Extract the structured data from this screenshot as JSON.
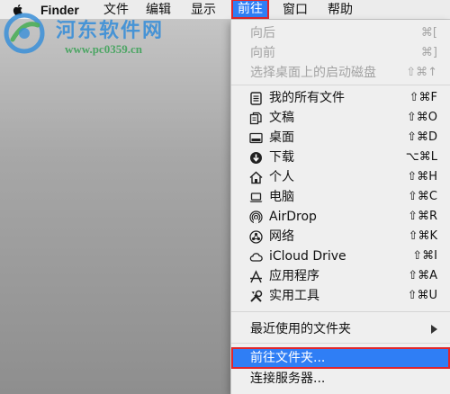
{
  "menubar": {
    "finder": "Finder",
    "file": "文件",
    "edit": "编辑",
    "view": "显示",
    "go": "前往",
    "window": "窗口",
    "help": "帮助"
  },
  "watermark": {
    "title": "河东软件网",
    "url": "www.pc0359.cn"
  },
  "menu": {
    "nav": [
      {
        "label": "向后",
        "shortcut": "⌘[",
        "enabled": false
      },
      {
        "label": "向前",
        "shortcut": "⌘]",
        "enabled": false
      },
      {
        "label": "选择桌面上的启动磁盘",
        "shortcut": "⇧⌘↑",
        "enabled": false
      }
    ],
    "places": [
      {
        "label": "我的所有文件",
        "shortcut": "⇧⌘F",
        "icon": "all-files-icon"
      },
      {
        "label": "文稿",
        "shortcut": "⇧⌘O",
        "icon": "documents-icon"
      },
      {
        "label": "桌面",
        "shortcut": "⇧⌘D",
        "icon": "desktop-icon"
      },
      {
        "label": "下载",
        "shortcut": "⌥⌘L",
        "icon": "downloads-icon"
      },
      {
        "label": "个人",
        "shortcut": "⇧⌘H",
        "icon": "home-icon"
      },
      {
        "label": "电脑",
        "shortcut": "⇧⌘C",
        "icon": "computer-icon"
      },
      {
        "label": "AirDrop",
        "shortcut": "⇧⌘R",
        "icon": "airdrop-icon"
      },
      {
        "label": "网络",
        "shortcut": "⇧⌘K",
        "icon": "network-icon"
      },
      {
        "label": "iCloud Drive",
        "shortcut": "⇧⌘I",
        "icon": "icloud-icon"
      },
      {
        "label": "应用程序",
        "shortcut": "⇧⌘A",
        "icon": "applications-icon"
      },
      {
        "label": "实用工具",
        "shortcut": "⇧⌘U",
        "icon": "utilities-icon"
      }
    ],
    "recent": "最近使用的文件夹",
    "goto_folder": "前往文件夹...",
    "connect_server": "连接服务器..."
  },
  "colors": {
    "highlight": "#2f7ef5",
    "callout": "#e0262b"
  }
}
